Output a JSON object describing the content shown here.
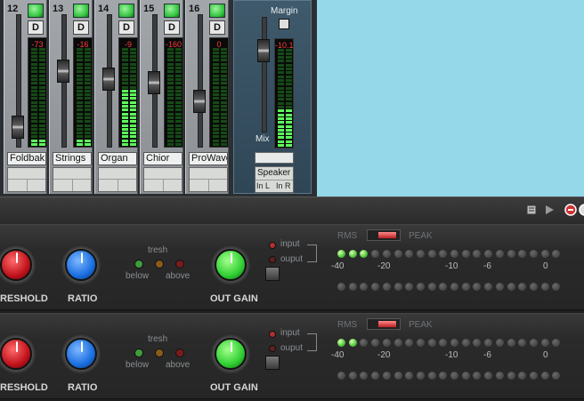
{
  "mixer": {
    "channels": [
      {
        "number": "12",
        "d_label": "D",
        "peak": "-73",
        "name": "Foldbak",
        "fader": 0.14,
        "level": 0.05
      },
      {
        "number": "13",
        "d_label": "D",
        "peak": "-16",
        "name": "Strings",
        "fader": 0.57,
        "level": 0.06
      },
      {
        "number": "14",
        "d_label": "D",
        "peak": "-9",
        "name": "Organ",
        "fader": 0.51,
        "level": 0.55
      },
      {
        "number": "15",
        "d_label": "D",
        "peak": "-160",
        "name": "Chior",
        "fader": 0.48,
        "level": 0.0
      },
      {
        "number": "16",
        "d_label": "D",
        "peak": "0",
        "name": "ProWave",
        "fader": 0.34,
        "level": 0.0
      }
    ],
    "master": {
      "margin_label": "Margin",
      "mix_label": "Mix",
      "peak": "-10.1",
      "output_name": "Speaker",
      "port_left": "In L",
      "port_right": "In R",
      "fader": 0.7,
      "level": 0.35
    }
  },
  "compressors": [
    {
      "threshold_label": "RESHOLD",
      "ratio_label": "RATIO",
      "out_gain_label": "OUT GAIN",
      "tresh_label": "tresh",
      "below_label": "below",
      "above_label": "above",
      "input_label": "input",
      "output_label": "ouput",
      "rms_label": "RMS",
      "peak_label": "PEAK",
      "scale": [
        "-40",
        "-20",
        "-10",
        "-6",
        "0"
      ],
      "lit_leds": 3
    },
    {
      "threshold_label": "RESHOLD",
      "ratio_label": "RATIO",
      "out_gain_label": "OUT GAIN",
      "tresh_label": "tresh",
      "below_label": "below",
      "above_label": "above",
      "input_label": "input",
      "output_label": "ouput",
      "rms_label": "RMS",
      "peak_label": "PEAK",
      "scale": [
        "-40",
        "-20",
        "-10",
        "-6",
        "0"
      ],
      "lit_leds": 2
    }
  ],
  "colors": {
    "threshold_knob": "#c0121c",
    "ratio_knob": "#1a6fe0",
    "out_gain_knob": "#2fcf32",
    "sky": "#95d8ea"
  },
  "icons": [
    "list-icon",
    "play-icon",
    "close-icon",
    "minimize-icon"
  ]
}
